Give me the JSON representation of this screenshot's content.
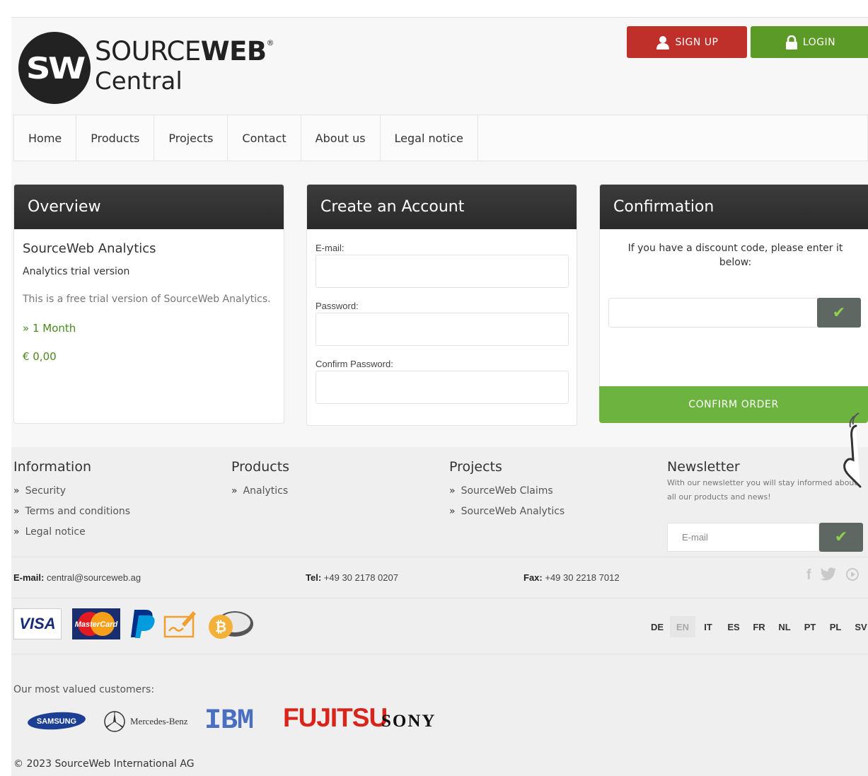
{
  "brand": {
    "mark": "SW",
    "name_light": "SOURCE",
    "name_bold": "WEB",
    "registered": "®",
    "sub": "Central"
  },
  "header": {
    "signup_label": "SIGN UP",
    "login_label": "LOGIN",
    "signup_color": "#c0302b",
    "login_color": "#5b9a26"
  },
  "nav": {
    "items": [
      "Home",
      "Products",
      "Projects",
      "Contact",
      "About us",
      "Legal notice"
    ]
  },
  "overview": {
    "heading": "Overview",
    "product": "SourceWeb Analytics",
    "subtitle": "Analytics trial version",
    "description": "This is a free trial version of SourceWeb Analytics.",
    "duration": "1 Month",
    "price": "€ 0,00"
  },
  "account": {
    "heading": "Create an Account",
    "email_label": "E-mail:",
    "password_label": "Password:",
    "confirm_label": "Confirm Password:"
  },
  "confirmation": {
    "heading": "Confirmation",
    "text": "If you have a discount code, please enter it below:",
    "confirm_label": "CONFIRM ORDER",
    "accent": "#6db33f"
  },
  "footer": {
    "information": {
      "heading": "Information",
      "links": [
        "Security",
        "Terms and conditions",
        "Legal notice"
      ]
    },
    "products": {
      "heading": "Products",
      "links": [
        "Analytics"
      ]
    },
    "projects": {
      "heading": "Projects",
      "links": [
        "SourceWeb Claims",
        "SourceWeb Analytics"
      ]
    },
    "newsletter": {
      "heading": "Newsletter",
      "text": "With our newsletter you will stay informed about all our products and news!",
      "placeholder": "E-mail"
    },
    "contact": {
      "email_label": "E-mail:",
      "email": "central@sourceweb.ag",
      "tel_label": "Tel:",
      "tel": "+49 30 2178 0207",
      "fax_label": "Fax:",
      "fax": "+49 30 2218 7012"
    },
    "social_icons": [
      "facebook-icon",
      "twitter-icon",
      "youtube-icon"
    ],
    "payments": {
      "visa": "VISA",
      "mastercard": "MasterCard",
      "others": [
        "paypal-icon",
        "cheque-icon",
        "bitcoin-icon"
      ]
    },
    "languages": [
      "DE",
      "EN",
      "IT",
      "ES",
      "FR",
      "NL",
      "PT",
      "PL",
      "SV"
    ],
    "active_language": "EN",
    "customers_label": "Our most valued customers:",
    "customers": [
      "SAMSUNG",
      "Mercedes-Benz",
      "IBM",
      "FUJITSU",
      "SONY"
    ],
    "copyright": "© 2023 SourceWeb International AG"
  }
}
